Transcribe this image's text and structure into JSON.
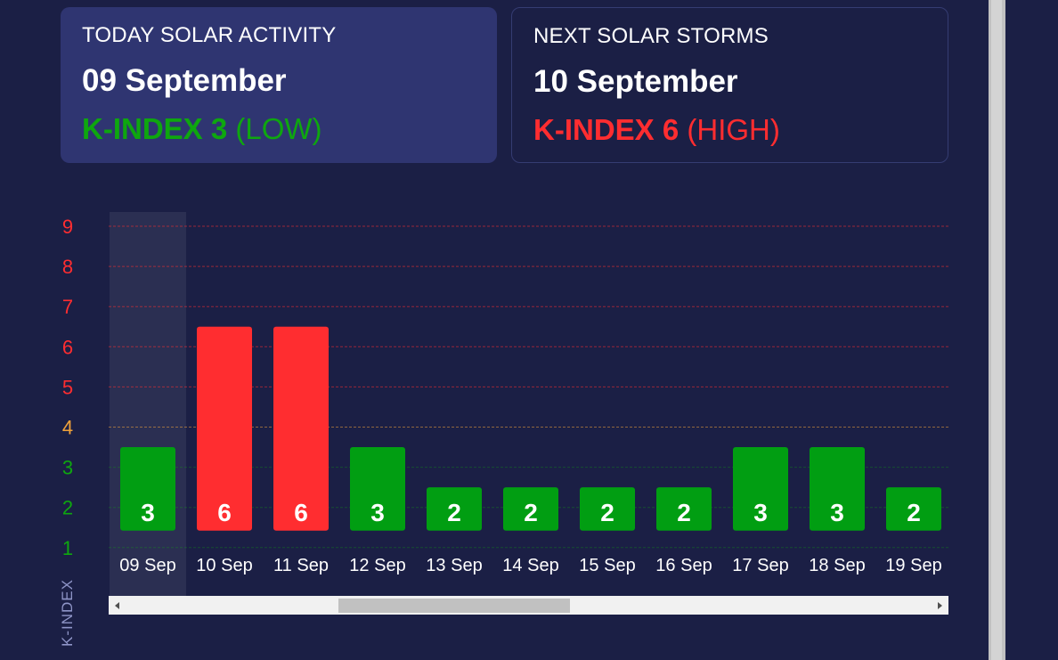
{
  "today_card": {
    "heading": "TODAY SOLAR ACTIVITY",
    "date": "09 September",
    "kindex_label": "K-INDEX 3",
    "kindex_level": "(LOW)",
    "color": "#0ea70f"
  },
  "next_card": {
    "heading": "NEXT SOLAR STORMS",
    "date": "10 September",
    "kindex_label": "K-INDEX 6",
    "kindex_level": "(HIGH)",
    "color": "#ff2d30"
  },
  "chart_data": {
    "type": "bar",
    "ylabel": "K-INDEX",
    "y_ticks": [
      "1",
      "2",
      "3",
      "4",
      "5",
      "6",
      "7",
      "8",
      "9"
    ],
    "y_tick_colors": [
      "#0ea70f",
      "#0ea70f",
      "#0ea70f",
      "#f0a23a",
      "#ff2d30",
      "#ff2d30",
      "#ff2d30",
      "#ff2d30",
      "#ff2d30"
    ],
    "ylim": [
      1,
      9
    ],
    "categories": [
      "09 Sep",
      "10 Sep",
      "11 Sep",
      "12 Sep",
      "13 Sep",
      "14 Sep",
      "15 Sep",
      "16 Sep",
      "17 Sep",
      "18 Sep",
      "19 Sep"
    ],
    "values": [
      3,
      6,
      6,
      3,
      2,
      2,
      2,
      2,
      3,
      3,
      2
    ],
    "bar_colors": [
      "#019e12",
      "#ff2d30",
      "#ff2d30",
      "#019e12",
      "#019e12",
      "#019e12",
      "#019e12",
      "#019e12",
      "#019e12",
      "#019e12",
      "#019e12"
    ],
    "highlighted_category": "09 Sep",
    "grid": true
  }
}
